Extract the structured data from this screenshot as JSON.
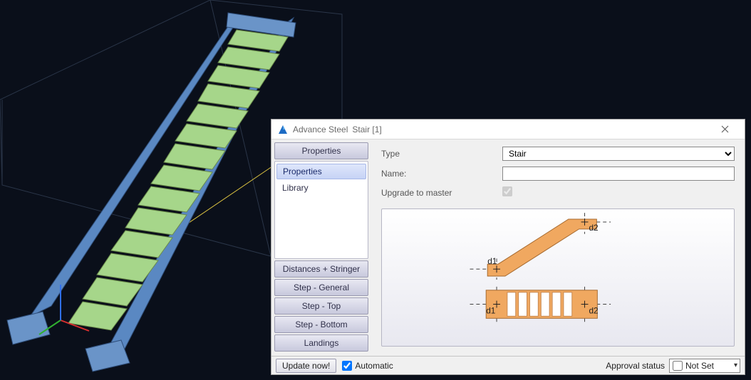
{
  "viewport": {
    "axis_colors": {
      "x": "#d93030",
      "y": "#30b030",
      "z": "#3070f0"
    }
  },
  "dialog": {
    "app_name": "Advance Steel",
    "object_title": "Stair [1]",
    "nav": {
      "sections": [
        "Properties",
        "Distances + Stringer",
        "Step - General",
        "Step - Top",
        "Step - Bottom",
        "Landings"
      ],
      "tree_items": [
        "Properties",
        "Library"
      ],
      "selected_tree_item": "Properties"
    },
    "form": {
      "type_label": "Type",
      "type_value": "Stair",
      "name_label": "Name:",
      "name_value": "",
      "upgrade_label": "Upgrade to master",
      "upgrade_checked": true
    },
    "diagram": {
      "labels": {
        "d1a": "d1",
        "d2a": "d2",
        "d1b": "d1",
        "d2b": "d2"
      },
      "colors": {
        "fill": "#f0a860",
        "dash": "#404040"
      }
    },
    "footer": {
      "update_label": "Update now!",
      "automatic_label": "Automatic",
      "automatic_checked": true,
      "approval_label": "Approval status",
      "approval_check": false,
      "approval_value": "Not Set"
    }
  }
}
